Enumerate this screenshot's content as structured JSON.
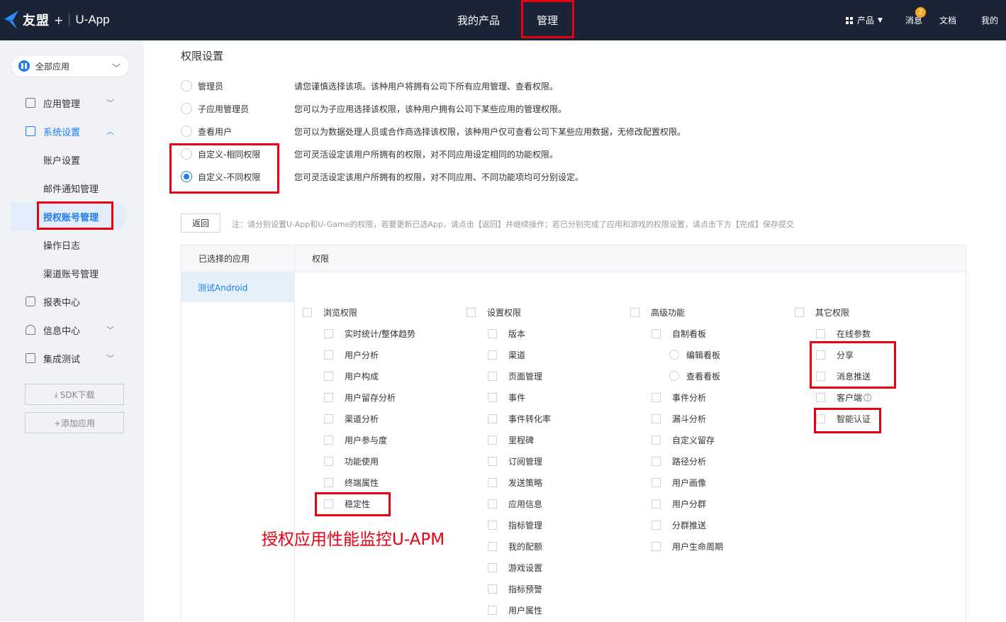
{
  "header": {
    "brand": "友盟",
    "brand_plus": "+",
    "product": "U-App",
    "nav": [
      "我的产品",
      "管理"
    ],
    "right": {
      "products": "产品",
      "messages": "消息",
      "messages_badge": "2",
      "docs": "文档",
      "mine": "我的"
    }
  },
  "sidebar": {
    "app_selector": "全部应用",
    "items": [
      {
        "label": "应用管理",
        "chevron": "down"
      },
      {
        "label": "系统设置",
        "chevron": "up"
      },
      {
        "label": "账户设置"
      },
      {
        "label": "邮件通知管理"
      },
      {
        "label": "授权账号管理"
      },
      {
        "label": "操作日志"
      },
      {
        "label": "渠道账号管理"
      },
      {
        "label": "报表中心"
      },
      {
        "label": "信息中心",
        "chevron": "down"
      },
      {
        "label": "集成测试",
        "chevron": "down"
      }
    ],
    "sdk_download": "SDK下载",
    "add_app": "+添加应用"
  },
  "main": {
    "title": "权限设置",
    "options": [
      {
        "name": "管理员",
        "desc": "请您谨慎选择该项。该种用户将拥有公司下所有应用管理、查看权限。",
        "checked": false
      },
      {
        "name": "子应用管理员",
        "desc": "您可以为子应用选择该权限，该种用户拥有公司下某些应用的管理权限。",
        "checked": false
      },
      {
        "name": "查看用户",
        "desc": "您可以为数据处理人员或合作商选择该权限，该种用户仅可查看公司下某些应用数据，无修改配置权限。",
        "checked": false
      },
      {
        "name": "自定义-相同权限",
        "desc": "您可灵活设定该用户所拥有的权限，对不同应用设定相同的功能权限。",
        "checked": false
      },
      {
        "name": "自定义-不同权限",
        "desc": "您可灵活设定该用户所拥有的权限，对不同应用、不同功能项均可分别设定。",
        "checked": true
      }
    ],
    "back_button": "返回",
    "note": "注：请分别设置U-App和U-Game的权限，若要更新已选App，请点击【返回】并继续操作；若已分别完成了应用和游戏的权限设置，请点击下方【完成】保存提交",
    "table": {
      "col_apps": "已选择的应用",
      "col_perms": "权限",
      "selected_app": "测试Android",
      "groups": {
        "browse": {
          "title": "浏览权限",
          "items": [
            "实时统计/整体趋势",
            "用户分析",
            "用户构成",
            "用户留存分析",
            "渠道分析",
            "用户参与度",
            "功能使用",
            "终端属性",
            "稳定性"
          ]
        },
        "settings": {
          "title": "设置权限",
          "items": [
            "版本",
            "渠道",
            "页面管理",
            "事件",
            "事件转化率",
            "里程碑",
            "订阅管理",
            "发送策略",
            "应用信息",
            "指标管理",
            "我的配额",
            "游戏设置",
            "指标预警",
            "用户属性"
          ]
        },
        "advanced": {
          "title": "高级功能",
          "items": [
            "自制看板",
            "编辑看板",
            "查看看板",
            "事件分析",
            "漏斗分析",
            "自定义留存",
            "路径分析",
            "用户画像",
            "用户分群",
            "分群推送",
            "用户生命周期"
          ]
        },
        "other": {
          "title": "其它权限",
          "items": [
            "在线参数",
            "分享",
            "消息推送",
            "客户端",
            "智能认证"
          ]
        }
      }
    }
  },
  "annotation": "授权应用性能监控U-APM",
  "colors": {
    "accent": "#1e7cf0",
    "topbar": "#1b2337",
    "highlight": "#e60012",
    "badge": "#f5a623"
  }
}
